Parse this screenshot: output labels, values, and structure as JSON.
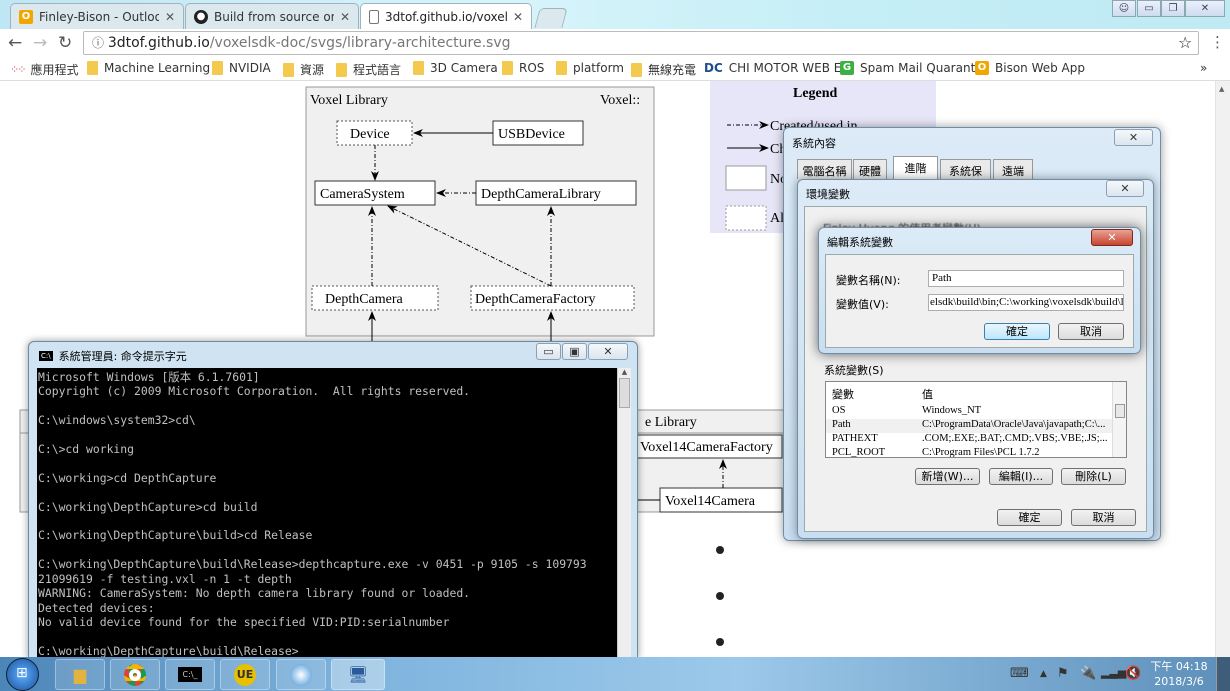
{
  "browser": {
    "tabs": [
      {
        "label": "Finley-Bison - Outlook W",
        "icon": "outlook-icon"
      },
      {
        "label": "Build from source on W",
        "icon": "github-icon"
      },
      {
        "label": "3dtof.github.io/voxelsd",
        "icon": "page-icon"
      }
    ],
    "close_glyph": "✕",
    "url_host": "3dtof.github.io",
    "url_path": "/voxelsdk-doc/svgs/library-architecture.svg",
    "bookmarks": [
      {
        "label": "應用程式",
        "icon": "apps-icon"
      },
      {
        "label": "Machine Learning",
        "icon": "folder-icon"
      },
      {
        "label": "NVIDIA",
        "icon": "folder-icon"
      },
      {
        "label": "資源",
        "icon": "folder-icon"
      },
      {
        "label": "程式語言",
        "icon": "folder-icon"
      },
      {
        "label": "3D Camera",
        "icon": "folder-icon"
      },
      {
        "label": "ROS",
        "icon": "folder-icon"
      },
      {
        "label": "platform",
        "icon": "folder-icon"
      },
      {
        "label": "無線充電",
        "icon": "folder-icon"
      },
      {
        "label": "CHI MOTOR WEB EF",
        "icon": "chi-motor-icon"
      },
      {
        "label": "Spam Mail Quaranti",
        "icon": "g-icon"
      },
      {
        "label": "Bison Web App",
        "icon": "outlook-icon"
      }
    ],
    "more_bookmarks": "»"
  },
  "diagram": {
    "library_title": "Voxel Library",
    "namespace": "Voxel::",
    "nodes": {
      "device": "Device",
      "usb_device": "USBDevice",
      "camera_system": "CameraSystem",
      "depth_camera_library": "DepthCameraLibrary",
      "depth_camera": "DepthCamera",
      "depth_camera_factory": "DepthCameraFactory"
    },
    "lower_library_title": "e Library",
    "lower_nodes": {
      "factory": "Voxel14CameraFactory",
      "camera": "Voxel14Camera"
    },
    "legend": {
      "title": "Legend",
      "created": "Created/used in",
      "child": "Ch",
      "normal": "No",
      "abstract": "Al"
    }
  },
  "cmd": {
    "title": "系統管理員: 命令提示字元",
    "lines": [
      "Microsoft Windows [版本 6.1.7601]",
      "Copyright (c) 2009 Microsoft Corporation.  All rights reserved.",
      "",
      "C:\\windows\\system32>cd\\",
      "",
      "C:\\>cd working",
      "",
      "C:\\working>cd DepthCapture",
      "",
      "C:\\working\\DepthCapture>cd build",
      "",
      "C:\\working\\DepthCapture\\build>cd Release",
      "",
      "C:\\working\\DepthCapture\\build\\Release>depthcapture.exe -v 0451 -p 9105 -s 109793",
      "21099619 -f testing.vxl -n 1 -t depth",
      "WARNING: CameraSystem: No depth camera library found or loaded.",
      "Detected devices:",
      "No valid device found for the specified VID:PID:serialnumber",
      "",
      "C:\\working\\DepthCapture\\build\\Release>"
    ]
  },
  "sysprops": {
    "title": "系統內容",
    "tabs": [
      "電腦名稱",
      "硬體",
      "進階",
      "系統保護",
      "遠端"
    ],
    "active_tab": "進階"
  },
  "envvars": {
    "title": "環境變數",
    "user_vars_label": "Finley-Huang 的使用者變數(U)",
    "system_vars_label": "系統變數(S)",
    "columns": [
      "變數",
      "值"
    ],
    "rows": [
      {
        "name": "OS",
        "value": "Windows_NT"
      },
      {
        "name": "Path",
        "value": "C:\\ProgramData\\Oracle\\Java\\javapath;C:\\..."
      },
      {
        "name": "PATHEXT",
        "value": ".COM;.EXE;.BAT;.CMD;.VBS;.VBE;.JS;..."
      },
      {
        "name": "PCL_ROOT",
        "value": "C:\\Program Files\\PCL 1.7.2"
      }
    ],
    "new_button": "新增(W)...",
    "edit_button": "編輯(I)...",
    "delete_button": "刪除(L)",
    "ok": "確定",
    "cancel": "取消"
  },
  "editvar": {
    "title": "編輯系統變數",
    "name_label": "變數名稱(N):",
    "name_value": "Path",
    "value_label": "變數值(V):",
    "value_value": "elsdk\\build\\bin;C:\\working\\voxelsdk\\build\\lib",
    "ok": "確定",
    "cancel": "取消"
  },
  "taskbar": {
    "apps": [
      "windows-explorer-icon",
      "chrome-icon",
      "cmd-icon",
      "ultraedit-icon",
      "blue-app-icon",
      "system-properties-icon"
    ],
    "time": "下午 04:18",
    "date": "2018/3/6"
  }
}
